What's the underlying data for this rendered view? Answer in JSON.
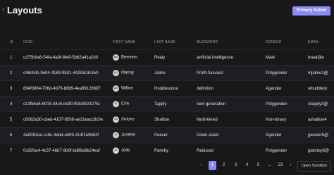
{
  "header": {
    "title": "Layouts",
    "primary_action": "Primary Action"
  },
  "table": {
    "columns": [
      "ID",
      "GUID",
      "FIRST NAME",
      "LAST NAME",
      "BUZZWORD",
      "GENDER",
      "EMAIL"
    ],
    "rows": [
      {
        "id": "1",
        "guid": "cd75b6a6-54fa-4a0f-8fe9-5b62a41a2d0",
        "initials": "BR",
        "first": "Brennen",
        "last": "Realy",
        "buzzword": "artificial intelligence",
        "gender": "Male",
        "email": "breal@e"
      },
      {
        "id": "2",
        "guid": "c48cfefc-9e04-4169-9b31-442b3c3c3e0",
        "initials": "MJ",
        "first": "Manny",
        "last": "Jaime",
        "buzzword": "Profit-focused",
        "gender": "Polygender",
        "email": "mjaime1@"
      },
      {
        "id": "3",
        "guid": "894f0864-706d-4b76-b889-4ea99128687",
        "initials": "WH",
        "first": "Wilton",
        "last": "Huddlestone",
        "buzzword": "definition",
        "gender": "Agender",
        "email": "whuddlest"
      },
      {
        "id": "4",
        "guid": "c13fb4a6-6019-44c5-bc90-f53c992327fe",
        "initials": "CT",
        "first": "Crin",
        "last": "Tapply",
        "buzzword": "next generation",
        "gender": "Polygender",
        "email": "ctapply3@"
      },
      {
        "id": "5",
        "guid": "c8082a30-cbed-4107-8566-ae21eacc9c0e",
        "initials": "AS",
        "first": "Antons",
        "last": "Shallow",
        "buzzword": "Multi-tiered",
        "gender": "Non-binary",
        "email": "ashallow4"
      },
      {
        "id": "6",
        "guid": "4a0081ee-cc8c-4ebd-a509-414f1e9b82f",
        "initials": "JP",
        "first": "Junette",
        "last": "Peever",
        "buzzword": "Down-sized",
        "gender": "Agender",
        "email": "jpeever5@"
      },
      {
        "id": "7",
        "guid": "0c92fac4-4c37-4bb7-9b0f-bd86a9b24eaf",
        "initials": "JP",
        "first": "Jolie",
        "last": "Palmby",
        "buzzword": "Reduced",
        "gender": "Polygender",
        "email": "jpalmby6@"
      },
      {
        "id": "8",
        "guid": "e5fab5c5-9ea5-4b11-97b5-59c1a1bcb5b",
        "initials": "JT",
        "first": "Jock",
        "last": "Tear",
        "buzzword": "orchestration",
        "gender": "Bigender",
        "email": "jtear7@"
      }
    ]
  },
  "pagination": {
    "prev": "‹",
    "pages": [
      "1",
      "2",
      "3",
      "4",
      "5"
    ],
    "ellipsis": "…",
    "last": "23",
    "next": "›",
    "active": "1"
  },
  "sandbox_button": "Open Sandbox",
  "colors": {
    "accent": "#8b8bf5",
    "background": "#18181b"
  }
}
